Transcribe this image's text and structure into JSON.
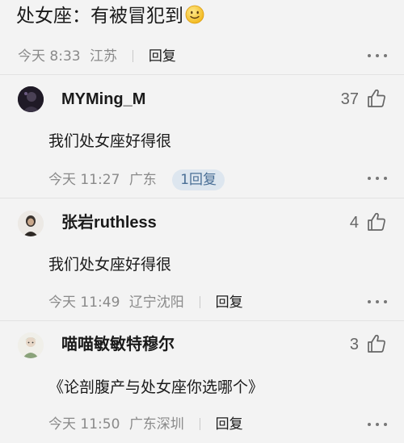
{
  "post": {
    "text": "处女座：有被冒犯到",
    "emoji_icon": "smiley-face-icon",
    "time": "今天 8:33",
    "location": "江苏",
    "reply_label": "回复"
  },
  "comments": [
    {
      "username": "MYMing_M",
      "likes": "37",
      "text": "我们处女座好得很",
      "time": "今天 11:27",
      "location": "广东",
      "reply_label": "1回复"
    },
    {
      "username": "张岩ruthless",
      "likes": "4",
      "text": "我们处女座好得很",
      "time": "今天 11:49",
      "location": "辽宁沈阳",
      "reply_label": "回复"
    },
    {
      "username": "喵喵敏敏特穆尔",
      "likes": "3",
      "text": "《论剖腹产与处女座你选哪个》",
      "time": "今天 11:50",
      "location": "广东深圳",
      "reply_label": "回复"
    }
  ],
  "icons": {
    "like": "thumbs-up-icon",
    "more": "more-dots-icon"
  },
  "colors": {
    "background": "#f3f3f3",
    "meta_text": "#8a8a8a",
    "reply_badge_bg": "#dde6ef",
    "reply_badge_text": "#4a6f96"
  }
}
